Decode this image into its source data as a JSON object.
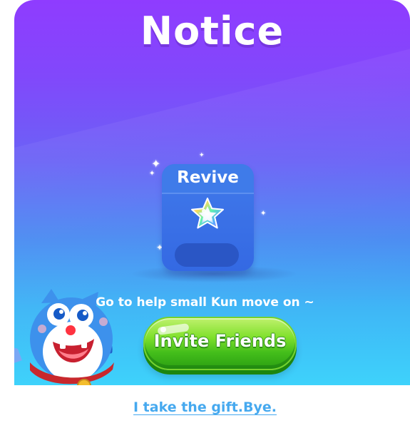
{
  "dialog": {
    "title": "Notice",
    "reward_card": {
      "label": "Revive",
      "icon": "rainbow-star-icon",
      "count_text": ""
    },
    "subtitle": "Go to help small Kun move on ~",
    "primary_button_label": "Invite Friends",
    "skip_link_label": "I take the gift.Bye.",
    "mascot": "blue-cat-mascot",
    "colors": {
      "background_top": "#8f3cff",
      "background_bottom": "#3ed2fb",
      "card": "#3469e3",
      "button": "#43be1b",
      "link": "#46a9ef"
    }
  }
}
